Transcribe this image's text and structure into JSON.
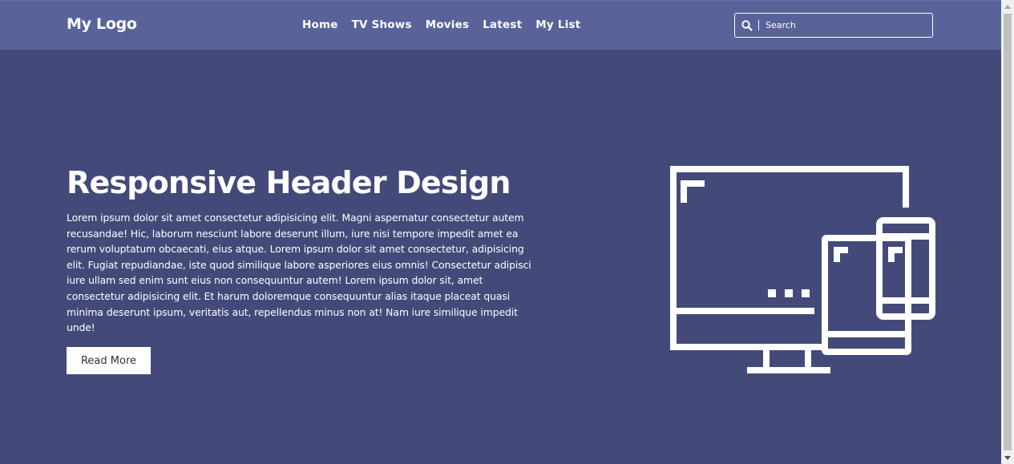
{
  "nav": {
    "logo": "My Logo",
    "links": [
      "Home",
      "TV Shows",
      "Movies",
      "Latest",
      "My List"
    ],
    "search_placeholder": "Search"
  },
  "hero": {
    "title": "Responsive Header Design",
    "text": "Lorem ipsum dolor sit amet consectetur adipisicing elit. Magni aspernatur consectetur autem recusandae! Hic, laborum nesciunt labore deserunt illum, iure nisi tempore impedit amet ea rerum voluptatum obcaecati, eius atque. Lorem ipsum dolor sit amet consectetur, adipisicing elit. Fugiat repudiandae, iste quod similique labore asperiores eius omnis! Consectetur adipisci iure ullam sed enim sunt eius non consequuntur autem! Lorem ipsum dolor sit, amet consectetur adipisicing elit. Et harum doloremque consequuntur alias itaque placeat quasi minima deserunt ipsum, veritatis aut, repellendus minus non at! Nam iure similique impedit unde!",
    "button_label": "Read More"
  },
  "icons": {
    "search": "search-icon",
    "illustration": "devices-icon"
  },
  "colors": {
    "navbar": "#5a629a",
    "background": "#434a7a",
    "text": "#ffffff",
    "button_bg": "#ffffff",
    "button_text": "#333333"
  }
}
